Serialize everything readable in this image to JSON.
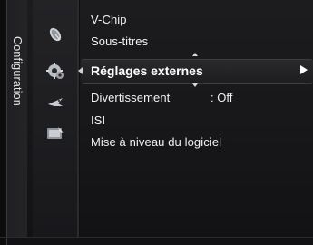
{
  "sidebar": {
    "title": "Configuration",
    "icons": [
      "satellite-dish-icon",
      "gear-icon",
      "bird-icon",
      "screen-settings-icon"
    ]
  },
  "menu": {
    "items": [
      {
        "label": "V-Chip"
      },
      {
        "label": "Sous-titres"
      },
      {
        "label": "Réglages externes",
        "selected": true
      },
      {
        "label": "Divertissement",
        "value": ": Off"
      },
      {
        "label": "ISI"
      },
      {
        "label": "Mise à niveau du logiciel"
      }
    ]
  }
}
